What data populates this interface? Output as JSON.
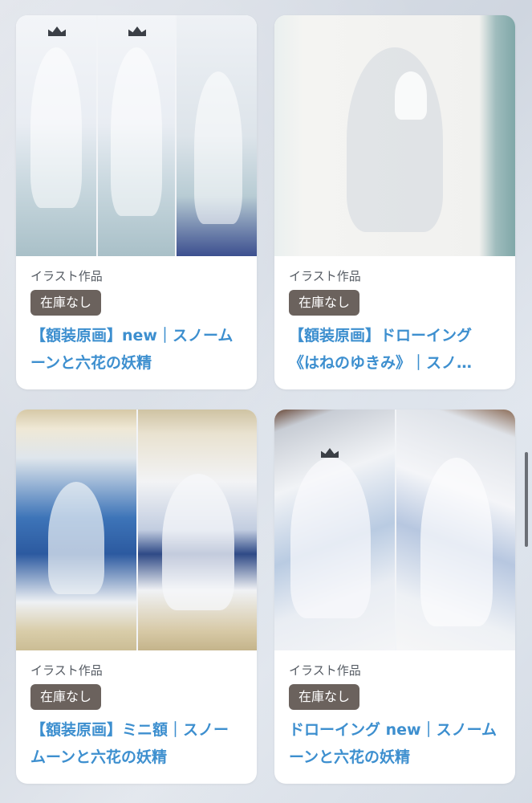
{
  "products": [
    {
      "category": "イラスト作品",
      "status": "在庫なし",
      "title": "【額装原画】new｜スノームーンと六花の妖精",
      "image_label": "snow moon fairy artwork"
    },
    {
      "category": "イラスト作品",
      "status": "在庫なし",
      "title": "【額装原画】ドローイング《はねのゆきみ》｜スノ…",
      "image_label": "framed drawing"
    },
    {
      "category": "イラスト作品",
      "status": "在庫なし",
      "title": "【額装原画】ミニ額｜スノームーンと六花の妖精",
      "image_label": "mini framed paintings"
    },
    {
      "category": "イラスト作品",
      "status": "在庫なし",
      "title": "ドローイング new｜スノームーンと六花の妖精",
      "image_label": "drawing sheets"
    }
  ],
  "colors": {
    "title": "#3d8fcf",
    "badge_bg": "#6b625d",
    "card_bg": "#ffffff"
  }
}
